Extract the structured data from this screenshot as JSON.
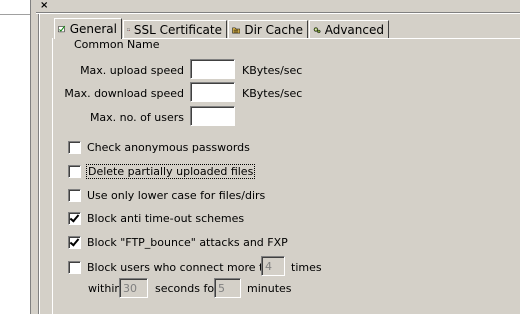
{
  "window": {
    "close_glyph": "×"
  },
  "tabs": [
    {
      "label": "General",
      "icon": "general-check-icon",
      "active": true
    },
    {
      "label": "SSL Certificate",
      "icon": "certificate-icon",
      "active": false
    },
    {
      "label": "Dir Cache",
      "icon": "dir-cache-icon",
      "active": false
    },
    {
      "label": "Advanced",
      "icon": "advanced-gear-icon",
      "active": false
    }
  ],
  "general": {
    "clipped_heading": "Common Name",
    "max_upload_label": "Max. upload speed",
    "max_upload_value": "",
    "max_download_label": "Max. download speed",
    "max_download_value": "",
    "kbytes_unit": "KBytes/sec",
    "max_users_label": "Max. no. of users",
    "max_users_value": ""
  },
  "checkboxes": {
    "anon_passwords": {
      "label": "Check anonymous passwords",
      "checked": false
    },
    "delete_partial": {
      "label": "Delete partially uploaded files",
      "checked": false
    },
    "lower_case": {
      "label": "Use only lower case for files/dirs",
      "checked": false
    },
    "anti_timeout": {
      "label": "Block anti time-out schemes",
      "checked": true
    },
    "ftp_bounce": {
      "label": "Block \"FTP_bounce\" attacks and FXP",
      "checked": true
    },
    "block_users": {
      "label": "Block users who connect more than",
      "checked": false
    }
  },
  "block_users": {
    "times_value": "4",
    "times_label": "times",
    "within_label": "within",
    "seconds_value": "30",
    "seconds_label": "seconds for",
    "minutes_value": "5",
    "minutes_label": "minutes"
  }
}
